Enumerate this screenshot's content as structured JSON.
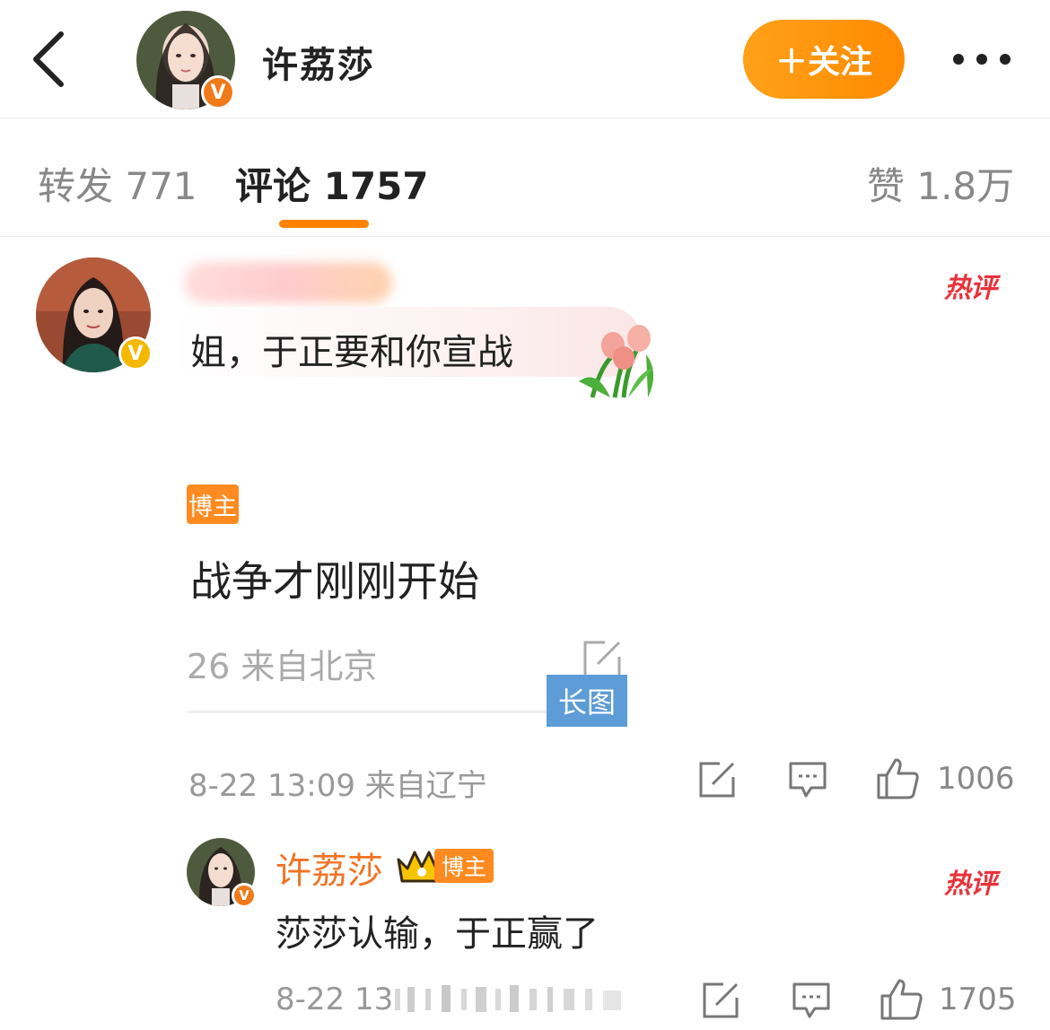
{
  "header": {
    "title": "许荔莎",
    "follow_label": "＋关注"
  },
  "tabs": {
    "repost": "转发 771",
    "comment": "评论 1757",
    "like": "赞 1.8万"
  },
  "colors": {
    "accent": "#ff8200",
    "hot_tag": "#e8333b",
    "blogger_name": "#f07424",
    "long_image_badge": "#5d9cd6"
  },
  "comment1": {
    "hot_label": "热评",
    "quoted_text": "姐，于正要和你宣战",
    "blogger_tag": "博主",
    "reply_text": "战争才刚刚开始",
    "embed_meta": "26 来自北京",
    "long_image_label": "长图",
    "meta": "8-22 13:09 来自辽宁",
    "like_count": "1006"
  },
  "comment2": {
    "hot_label": "热评",
    "name": "许荔莎",
    "blogger_tag": "博主",
    "body": "莎莎认输，于正赢了",
    "meta": "8-22 13",
    "like_count": "1705"
  }
}
